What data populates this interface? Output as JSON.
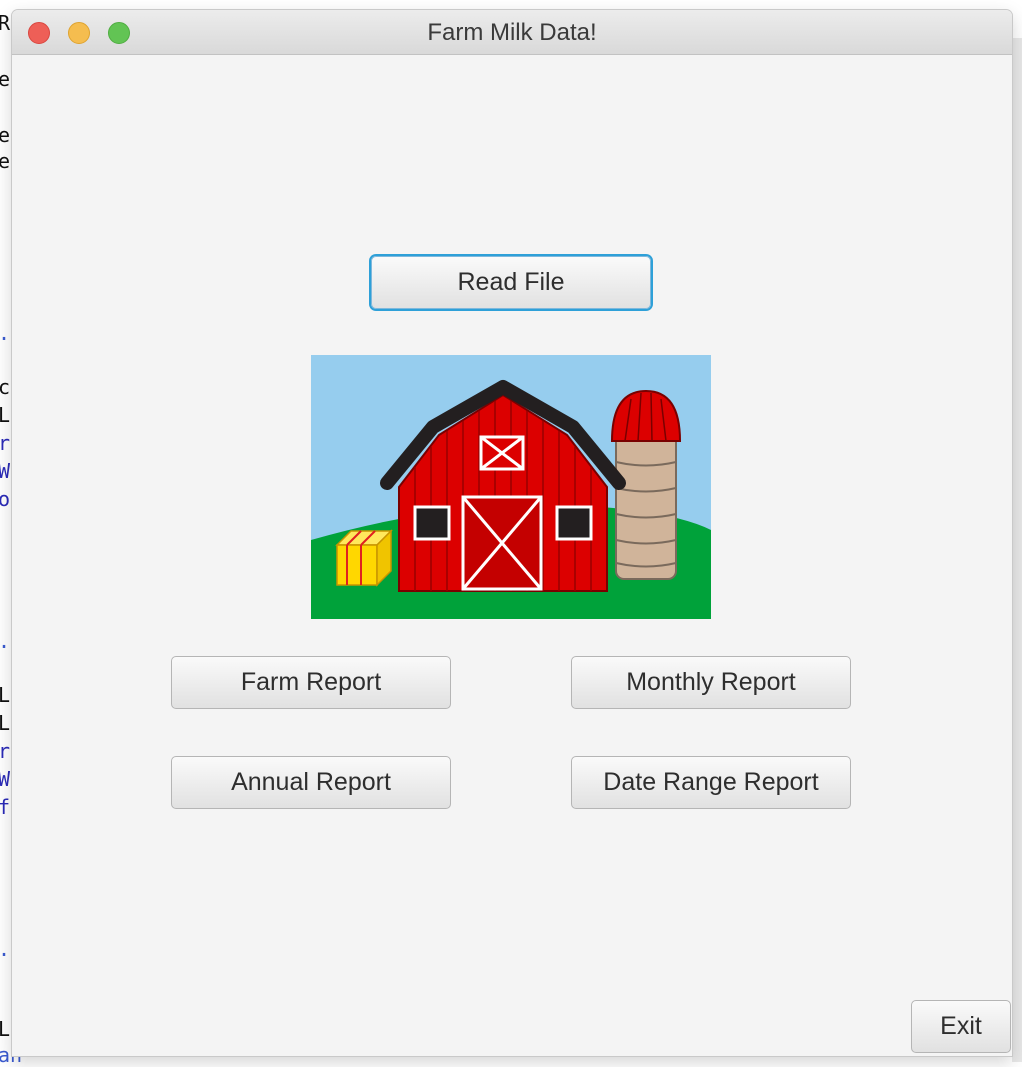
{
  "window": {
    "title": "Farm Milk Data!"
  },
  "buttons": {
    "read_file": "Read File",
    "farm_report": "Farm Report",
    "monthly_report": "Monthly Report",
    "annual_report": "Annual Report",
    "date_range_report": "Date Range Report",
    "exit": "Exit"
  },
  "image": {
    "name": "barn-illustration",
    "colors": {
      "sky": "#96cdee",
      "grass": "#00a23a",
      "barn": "#dc0000",
      "roof": "#231f20",
      "silo": "#d0b49a",
      "hay": "#ffd700"
    }
  },
  "background_fragments": [
    {
      "text": "Re",
      "style": "normal"
    },
    {
      "text": "e}",
      "style": "normal"
    },
    {
      "text": "er",
      "style": "normal"
    },
    {
      "text": "e(",
      "style": "normal"
    },
    {
      "text": ".e",
      "style": "lightblue"
    },
    {
      "text": "ce",
      "style": "normal"
    },
    {
      "text": "Le",
      "style": "normal"
    },
    {
      "text": "rt",
      "style": "blue"
    },
    {
      "text": "W",
      "style": "blue"
    },
    {
      "text": "o",
      "style": "blue"
    },
    {
      "text": ".e",
      "style": "lightblue"
    },
    {
      "text": "Le",
      "style": "normal"
    },
    {
      "text": "Le",
      "style": "normal"
    },
    {
      "text": "rt",
      "style": "blue"
    },
    {
      "text": "W",
      "style": "blue"
    },
    {
      "text": "f",
      "style": "blue"
    },
    {
      "text": ".e",
      "style": "lightblue"
    },
    {
      "text": "Le",
      "style": "normal"
    },
    {
      "text": "an",
      "style": "lightblue"
    }
  ]
}
